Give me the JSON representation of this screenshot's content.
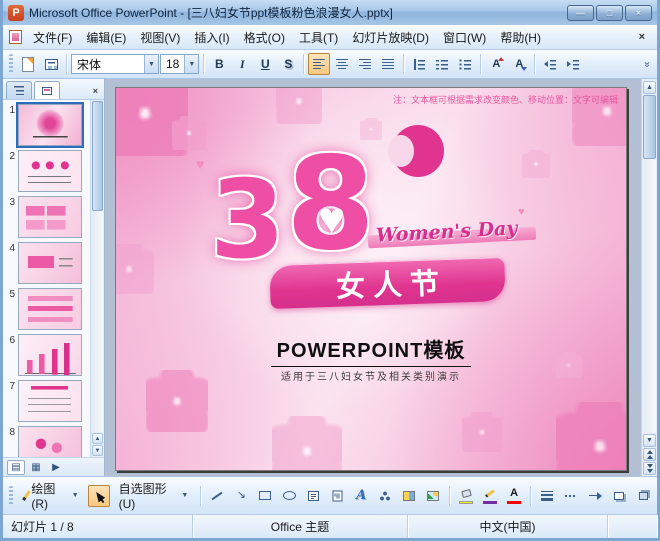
{
  "window": {
    "title": "Microsoft Office PowerPoint - [三八妇女节ppt模板粉色浪漫女人.pptx]"
  },
  "icons": {
    "app_glyph": "P",
    "minimize": "—",
    "maximize": "□",
    "close": "×",
    "menu_close": "×",
    "panel_close": "×",
    "dropdown_arrow": "▼",
    "overflow": "»",
    "up_arrow": "▲",
    "down_arrow": "▼",
    "bold": "B",
    "italic": "I",
    "underline": "U",
    "text_shadow": "S",
    "grow_font": "A",
    "shrink_font": "A",
    "arrow_se": "↘",
    "wordart": "A",
    "font_color": "A",
    "heart": "♥",
    "normal_view": "▤",
    "slide_sorter": "▦",
    "slideshow": "▶"
  },
  "menubar": {
    "items": [
      "文件(F)",
      "编辑(E)",
      "视图(V)",
      "插入(I)",
      "格式(O)",
      "工具(T)",
      "幻灯片放映(D)",
      "窗口(W)",
      "帮助(H)"
    ]
  },
  "toolbar": {
    "font_name": "宋体",
    "font_size": "18"
  },
  "slides_panel": {
    "numbers": [
      "1",
      "2",
      "3",
      "4",
      "5",
      "6",
      "7",
      "8"
    ]
  },
  "slide": {
    "note": "注：文本框可根据需求改变颜色、移动位置：文字可编辑",
    "digit_3": "3",
    "digit_8": "8",
    "script": "Women's Day",
    "banner": "女人节",
    "title": "POWERPOINT模板",
    "subtitle": "适用于三八妇女节及相关类别演示"
  },
  "drawbar": {
    "draw_label": "绘图(R)",
    "autoshapes_label": "自选图形(U)"
  },
  "statusbar": {
    "slide_indicator": "幻灯片 1 / 8",
    "theme": "Office 主题",
    "language": "中文(中国)"
  },
  "colors": {
    "accent_pink": "#e0348f",
    "deep_pink": "#d62f8d",
    "titlebar_blue": "#8fb5de",
    "fill_color": "#ffff00",
    "line_color": "#7030a0",
    "font_color": "#ff0000"
  }
}
